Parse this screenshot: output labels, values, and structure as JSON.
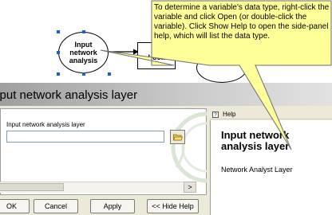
{
  "diagram": {
    "input_node_label": "Input\nnetwork\nanalysis",
    "tool_node_label": "A\nLoca"
  },
  "dialog": {
    "title": "Input network analysis layer",
    "field_label": "Input network analysis layer",
    "field_value": "",
    "buttons": {
      "ok": "OK",
      "cancel": "Cancel",
      "apply": "Apply",
      "hide_help": "<< Hide Help"
    },
    "scroll_right_glyph": ">"
  },
  "help": {
    "tab_label": "Help",
    "title": "Input network analysis layer",
    "body": "Network Analyst Layer"
  },
  "callout": {
    "text": "To determine a variable's data type, right-click the variable and click Open (or double-click the variable). Click Show Help to open the side-panel help, which will list the data type."
  },
  "colors": {
    "callout_fill": "#ffff99",
    "selection_handle": "#1c5cd6",
    "dialog_background": "#ece9d8"
  }
}
